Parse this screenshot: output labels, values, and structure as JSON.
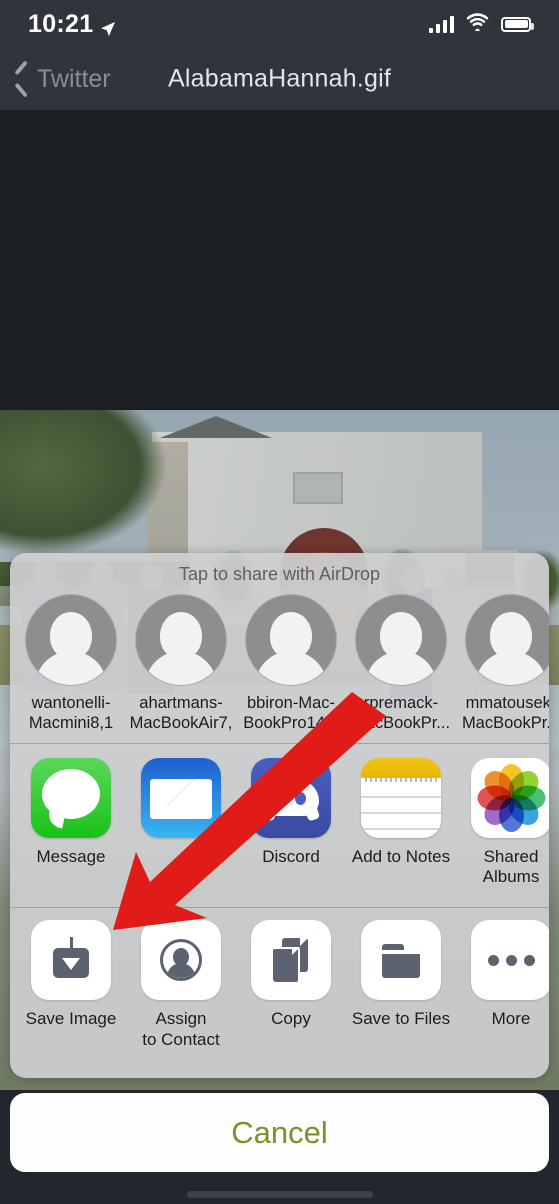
{
  "status_bar": {
    "time": "10:21",
    "location_icon": "location-arrow-icon",
    "signal_icon": "cellular-signal-icon",
    "wifi_icon": "wifi-icon",
    "battery_icon": "battery-full-icon"
  },
  "nav_bar": {
    "back_label": "Twitter",
    "back_icon": "chevron-left-icon",
    "title": "AlabamaHannah.gif"
  },
  "share_sheet": {
    "airdrop_title": "Tap to share with AirDrop",
    "airdrop_contacts": [
      {
        "name": "wantonelli-\nMacmini8,1",
        "avatar_icon": "person-silhouette-icon"
      },
      {
        "name": "ahartmans-\nMacBookAir7,",
        "avatar_icon": "person-silhouette-icon"
      },
      {
        "name": "bbiron-Mac-\nBookPro14,1",
        "avatar_icon": "person-silhouette-icon"
      },
      {
        "name": "rpremack-\nMacBookPr...",
        "avatar_icon": "person-silhouette-icon"
      },
      {
        "name": "mmatousek-\nMacBookPr...",
        "avatar_icon": "person-silhouette-icon"
      }
    ],
    "apps": [
      {
        "label": "Message",
        "icon": "messages-app-icon",
        "color": "#19c219"
      },
      {
        "label": "",
        "icon": "mail-app-icon",
        "color": "#2e86e0"
      },
      {
        "label": "Discord",
        "icon": "discord-app-icon",
        "color": "#404eb0"
      },
      {
        "label": "Add to Notes",
        "icon": "notes-app-icon",
        "color": "#e8b500"
      },
      {
        "label": "Shared\nAlbums",
        "icon": "photos-app-icon",
        "color": "#ffffff"
      }
    ],
    "actions": [
      {
        "label": "Save Image",
        "icon": "save-to-photos-icon"
      },
      {
        "label": "Assign\nto Contact",
        "icon": "assign-to-contact-icon"
      },
      {
        "label": "Copy",
        "icon": "copy-icon"
      },
      {
        "label": "Save to Files",
        "icon": "folder-icon"
      },
      {
        "label": "More",
        "icon": "ellipsis-icon"
      }
    ],
    "cancel_label": "Cancel",
    "cancel_color": "#7e8f2b"
  },
  "annotation": {
    "arrow_icon": "red-pointer-arrow",
    "arrow_color": "#e01b18",
    "points_to": "Save Image"
  },
  "background_photo": {
    "description": "outdoor wedding scene with white chapel and guests in suits"
  }
}
